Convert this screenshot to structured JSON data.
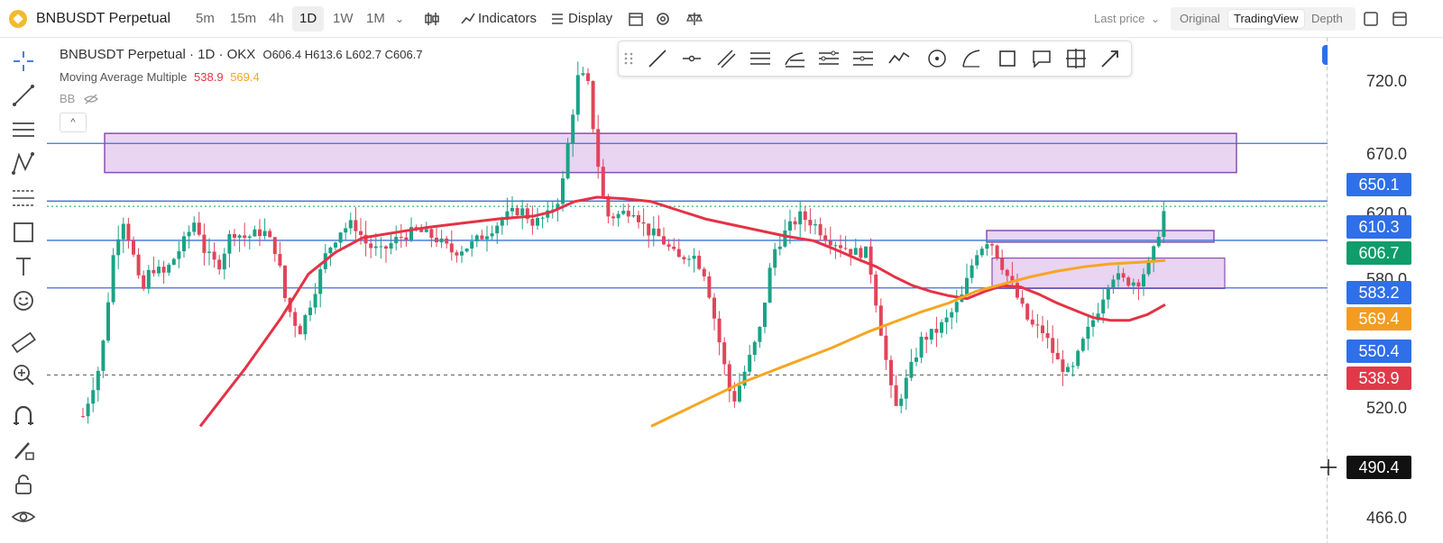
{
  "topbar": {
    "symbol": "BNBUSDT Perpetual",
    "timeframes": [
      "5m",
      "15m",
      "4h",
      "1D",
      "1W",
      "1M"
    ],
    "selected_timeframe": "1D",
    "indicators_label": "Indicators",
    "display_label": "Display",
    "price_source": "Last price",
    "views": [
      "Original",
      "TradingView",
      "Depth"
    ],
    "selected_view": "TradingView"
  },
  "legend": {
    "title": "BNBUSDT Perpetual · 1D · OKX",
    "ohlc": "O606.4  H613.6  L602.7  C606.7",
    "ma_label": "Moving Average Multiple",
    "ma1_value": "538.9",
    "ma2_value": "569.4",
    "bb_label": "BB"
  },
  "price_axis": {
    "ticks": [
      "720.0",
      "670.0",
      "620.0",
      "580.0",
      "520.0",
      "466.0"
    ]
  },
  "price_labels": [
    {
      "text": "650.1",
      "color": "#2f6fe8"
    },
    {
      "text": "610.3",
      "color": "#2f6fe8"
    },
    {
      "text": "606.7",
      "color": "#0f9d6b"
    },
    {
      "text": "583.2",
      "color": "#2f6fe8"
    },
    {
      "text": "569.4",
      "color": "#f39c22"
    },
    {
      "text": "550.4",
      "color": "#2f6fe8"
    },
    {
      "text": "538.9",
      "color": "#e03a4a"
    },
    {
      "text": "490.4",
      "color": "#111111"
    }
  ],
  "colors": {
    "up": "#1aa386",
    "down": "#e0455a",
    "ma1": "#e53245",
    "ma2": "#f5a623",
    "hline": "#3f6fd6",
    "zone_fill": "#e9d4f2",
    "zone_border": "#8a4fb0"
  },
  "icons": {
    "left_tools": [
      "crosshair-icon",
      "trendline-icon",
      "horizontal-lines-icon",
      "pattern-icon",
      "fib-icon",
      "rectangle-icon",
      "text-icon",
      "emoji-icon",
      "ruler-icon",
      "zoom-icon",
      "magnet-icon",
      "pencil-lock-icon",
      "lock-icon",
      "eye-icon"
    ],
    "drawing_tools": [
      "drag-handle-icon",
      "line-icon",
      "horizontal-ray-icon",
      "parallel-icon",
      "channel-icon",
      "fib-retracement-icon",
      "fib-extension-icon",
      "levels-icon",
      "polyline-icon",
      "circle-icon",
      "arc-icon",
      "rectangle-icon",
      "callout-icon",
      "crosshair-box-icon",
      "arrow-icon"
    ]
  }
}
